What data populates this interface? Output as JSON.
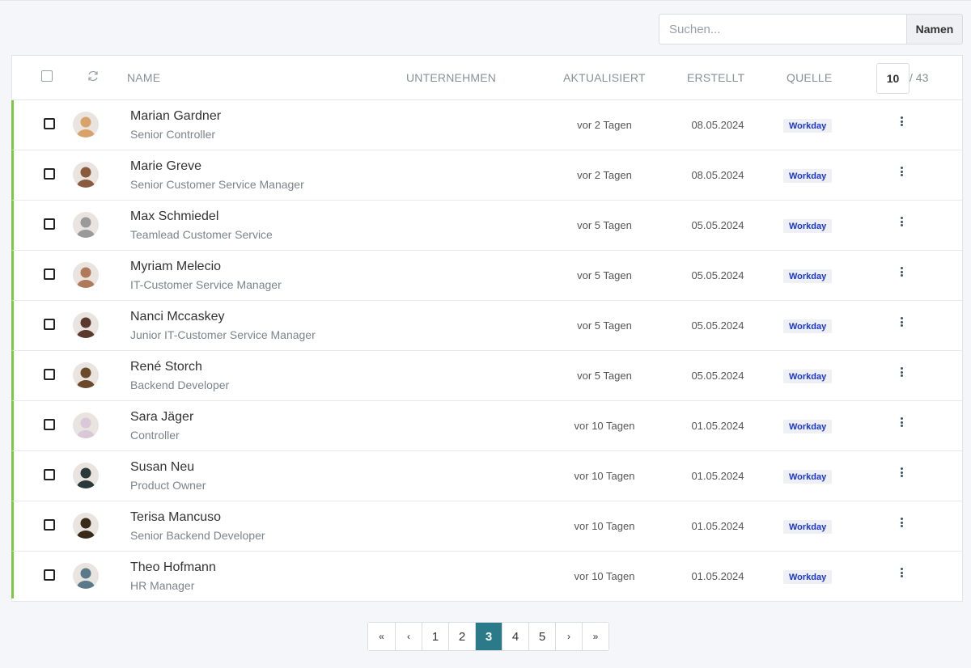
{
  "search": {
    "placeholder": "Suchen...",
    "button_label": "Namen"
  },
  "table": {
    "headers": {
      "name": "NAME",
      "company": "UNTERNEHMEN",
      "updated": "AKTUALISIERT",
      "created": "ERSTELLT",
      "source": "QUELLE"
    },
    "per_page": "10",
    "total": "/ 43",
    "rows": [
      {
        "name": "Marian Gardner",
        "role": "Senior Controller",
        "updated": "vor 2 Tagen",
        "created": "08.05.2024",
        "source": "Workday",
        "avatar_color": "#d8a26a"
      },
      {
        "name": "Marie Greve",
        "role": "Senior Customer Service Manager",
        "updated": "vor 2 Tagen",
        "created": "08.05.2024",
        "source": "Workday",
        "avatar_color": "#8a5a3c"
      },
      {
        "name": "Max Schmiedel",
        "role": "Teamlead Customer Service",
        "updated": "vor 5 Tagen",
        "created": "05.05.2024",
        "source": "Workday",
        "avatar_color": "#9a9a9a"
      },
      {
        "name": "Myriam Melecio",
        "role": "IT-Customer Service Manager",
        "updated": "vor 5 Tagen",
        "created": "05.05.2024",
        "source": "Workday",
        "avatar_color": "#b07a5a"
      },
      {
        "name": "Nanci Mccaskey",
        "role": "Junior IT-Customer Service Manager",
        "updated": "vor 5 Tagen",
        "created": "05.05.2024",
        "source": "Workday",
        "avatar_color": "#5a3a2c"
      },
      {
        "name": "René Storch",
        "role": "Backend Developer",
        "updated": "vor 5 Tagen",
        "created": "05.05.2024",
        "source": "Workday",
        "avatar_color": "#6a4a2a"
      },
      {
        "name": "Sara Jäger",
        "role": "Controller",
        "updated": "vor 10 Tagen",
        "created": "01.05.2024",
        "source": "Workday",
        "avatar_color": "#d8c8d8"
      },
      {
        "name": "Susan Neu",
        "role": "Product Owner",
        "updated": "vor 10 Tagen",
        "created": "01.05.2024",
        "source": "Workday",
        "avatar_color": "#2a3a3a"
      },
      {
        "name": "Terisa Mancuso",
        "role": "Senior Backend Developer",
        "updated": "vor 10 Tagen",
        "created": "01.05.2024",
        "source": "Workday",
        "avatar_color": "#3a2a1a"
      },
      {
        "name": "Theo Hofmann",
        "role": "HR Manager",
        "updated": "vor 10 Tagen",
        "created": "01.05.2024",
        "source": "Workday",
        "avatar_color": "#5a7a8a"
      }
    ]
  },
  "pagination": {
    "first": "«",
    "prev": "‹",
    "pages": [
      "1",
      "2",
      "3",
      "4",
      "5"
    ],
    "active": "3",
    "next": "›",
    "last": "»"
  },
  "colors": {
    "row_accent": "#7cc842",
    "active_page": "#2b7a89",
    "badge_text": "#1a35d6"
  }
}
